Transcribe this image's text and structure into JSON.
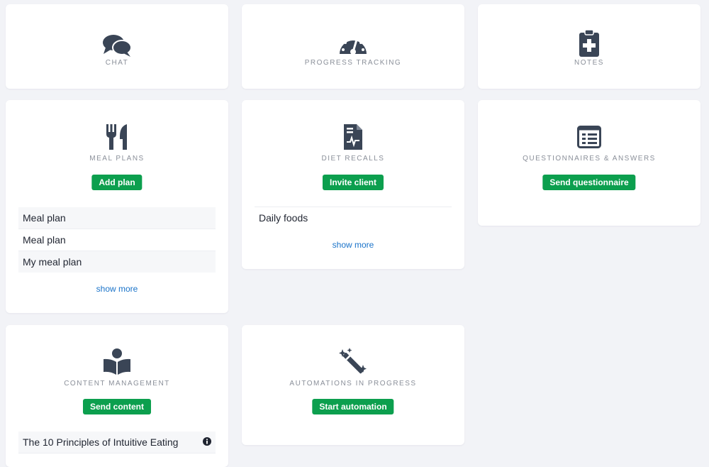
{
  "colors": {
    "background": "#f2f3f7",
    "card": "#ffffff",
    "accent_green": "#0c9f4e",
    "link_blue": "#1a73c9",
    "icon_dark": "#3a4556"
  },
  "cards": {
    "chat": {
      "title": "CHAT",
      "icon": "chat-bubbles-icon"
    },
    "progress": {
      "title": "PROGRESS TRACKING",
      "icon": "gauge-icon"
    },
    "notes": {
      "title": "NOTES",
      "icon": "clipboard-plus-icon"
    },
    "meal_plans": {
      "title": "MEAL PLANS",
      "icon": "utensils-icon",
      "button": "Add plan",
      "items": [
        "Meal plan",
        "Meal plan",
        "My meal plan"
      ],
      "show_more": "show more"
    },
    "diet_recalls": {
      "title": "DIET RECALLS",
      "icon": "document-chart-icon",
      "button": "Invite client",
      "items": [
        "Daily foods"
      ],
      "show_more": "show more"
    },
    "questionnaires": {
      "title": "QUESTIONNAIRES & ANSWERS",
      "icon": "form-list-icon",
      "button": "Send questionnaire"
    },
    "content": {
      "title": "CONTENT MANAGEMENT",
      "icon": "reader-book-icon",
      "button": "Send content",
      "items": [
        "The 10 Principles of Intuitive Eating"
      ]
    },
    "automations": {
      "title": "AUTOMATIONS IN PROGRESS",
      "icon": "magic-wand-icon",
      "button": "Start automation"
    }
  }
}
